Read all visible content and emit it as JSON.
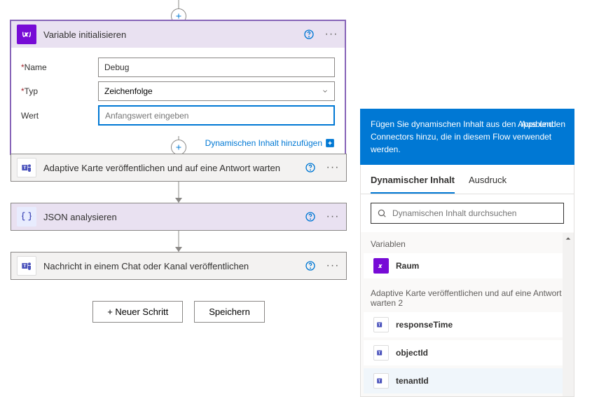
{
  "flow": {
    "step1": {
      "title": "Variable initialisieren",
      "fields": {
        "name_label": "Name",
        "name_value": "Debug",
        "type_label": "Typ",
        "type_value": "Zeichenfolge",
        "value_label": "Wert",
        "value_placeholder": "Anfangswert eingeben"
      },
      "dyn_link": "Dynamischen Inhalt hinzufügen"
    },
    "step2": {
      "title": "Adaptive Karte veröffentlichen und auf eine Antwort warten"
    },
    "step3": {
      "title": "JSON analysieren"
    },
    "step4": {
      "title": "Nachricht in einem Chat oder Kanal veröffentlichen"
    }
  },
  "footer": {
    "new_step": "+ Neuer Schritt",
    "save": "Speichern"
  },
  "panel": {
    "tip_text": "Fügen Sie dynamischen Inhalt aus den Apps und Connectors hinzu, die in diesem Flow verwendet werden.",
    "hide": "Ausblenden",
    "tab_dynamic": "Dynamischer Inhalt",
    "tab_expr": "Ausdruck",
    "search_placeholder": "Dynamischen Inhalt durchsuchen",
    "section_vars": "Variablen",
    "token_raum": "Raum",
    "section_adaptive": "Adaptive Karte veröffentlichen und auf eine Antwort warten 2",
    "token_responseTime": "responseTime",
    "token_objectId": "objectId",
    "token_tenantId": "tenantId"
  }
}
